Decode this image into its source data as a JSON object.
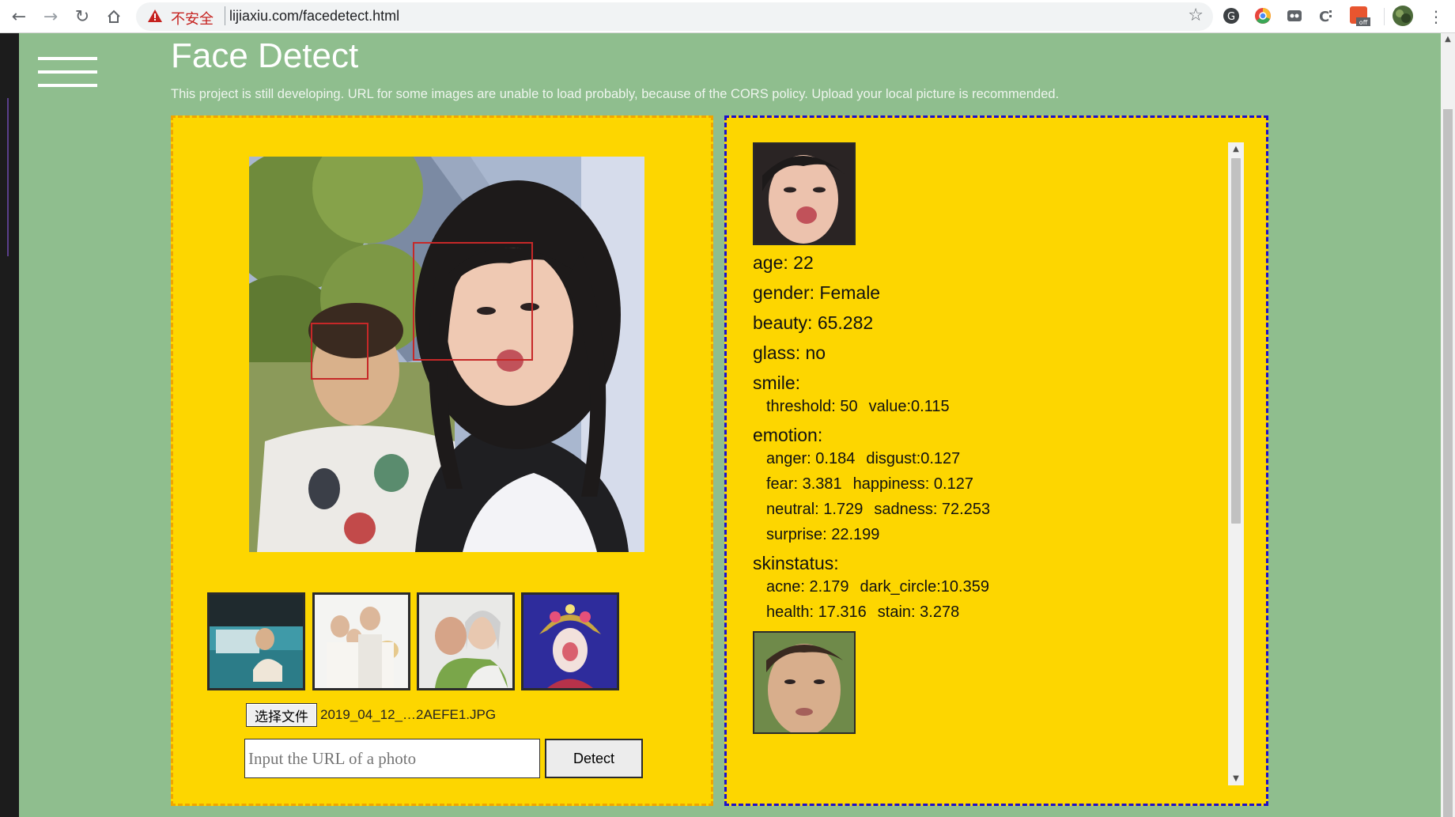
{
  "browser": {
    "insecure_label": "不安全",
    "url": "lijiaxiu.com/facedetect.html"
  },
  "header": {
    "title": "Face Detect",
    "subtitle": "This project is still developing. URL for some images are unable to load probably, because of the CORS policy. Upload your local picture is recommended."
  },
  "upload": {
    "choose_file_label": "选择文件",
    "file_name": "2019_04_12_…2AEFE1.JPG",
    "url_placeholder": "Input the URL of a photo",
    "detect_label": "Detect"
  },
  "results": {
    "faces": [
      {
        "age": "age: 22",
        "gender": "gender: Female",
        "beauty": "beauty: 65.282",
        "glass": "glass: no",
        "smile_label": "smile:",
        "smile_threshold": "threshold: 50",
        "smile_value": "value:0.115",
        "emotion_label": "emotion:",
        "emotion": {
          "anger": "anger: 0.184",
          "disgust": "disgust:0.127",
          "fear": "fear: 3.381",
          "happiness": "happiness: 0.127",
          "neutral": "neutral: 1.729",
          "sadness": "sadness: 72.253",
          "surprise": "surprise: 22.199"
        },
        "skinstatus_label": "skinstatus:",
        "skin": {
          "acne": "acne: 2.179",
          "dark_circle": "dark_circle:10.359",
          "health": "health: 17.316",
          "stain": "stain: 3.278"
        }
      }
    ]
  },
  "icons": [
    "back-arrow-icon",
    "forward-arrow-icon",
    "reload-icon",
    "home-icon",
    "warning-icon",
    "bookmark-star-icon",
    "extension-icon",
    "profile-avatar-icon",
    "hamburger-menu-icon"
  ],
  "colors": {
    "page_bg": "#8fbe8e",
    "panel_bg": "#fdd600",
    "left_border": "#f0a500",
    "right_border": "#1f10c9",
    "face_box": "#c62828"
  }
}
